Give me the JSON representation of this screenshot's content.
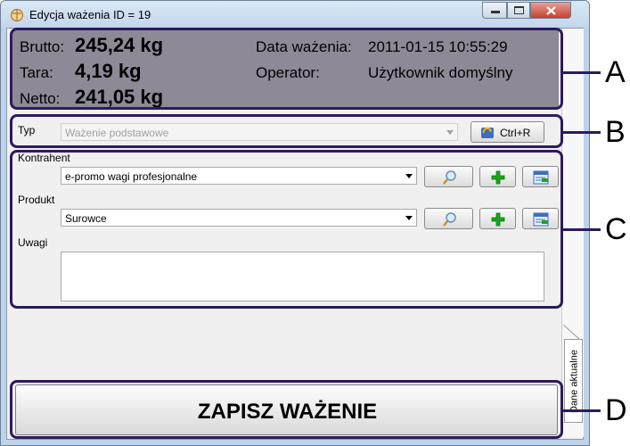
{
  "window": {
    "title": "Edycja ważenia ID = 19",
    "side_tab_label": "Dane aktualne"
  },
  "weights": {
    "brutto_label": "Brutto:",
    "brutto_value": "245,24 kg",
    "tara_label": "Tara:",
    "tara_value": "4,19 kg",
    "netto_label": "Netto:",
    "netto_value": "241,05 kg",
    "date_label": "Data ważenia:",
    "date_value": "2011-01-15 10:55:29",
    "operator_label": "Operator:",
    "operator_value": "Użytkownik domyślny"
  },
  "type": {
    "label": "Typ",
    "value": "Ważenie podstawowe",
    "shortcut_button": "Ctrl+R"
  },
  "contractor": {
    "label": "Kontrahent",
    "value": "e-promo wagi profesjonalne"
  },
  "product": {
    "label": "Produkt",
    "value": "Surowce"
  },
  "notes": {
    "label": "Uwagi",
    "value": ""
  },
  "save_button": "ZAPISZ WAŻENIE",
  "callouts": [
    "A",
    "B",
    "C",
    "D"
  ],
  "colors": {
    "weights_panel": "#8e8996",
    "callout": "#2e1a5c",
    "add_icon": "#1aa51a"
  }
}
